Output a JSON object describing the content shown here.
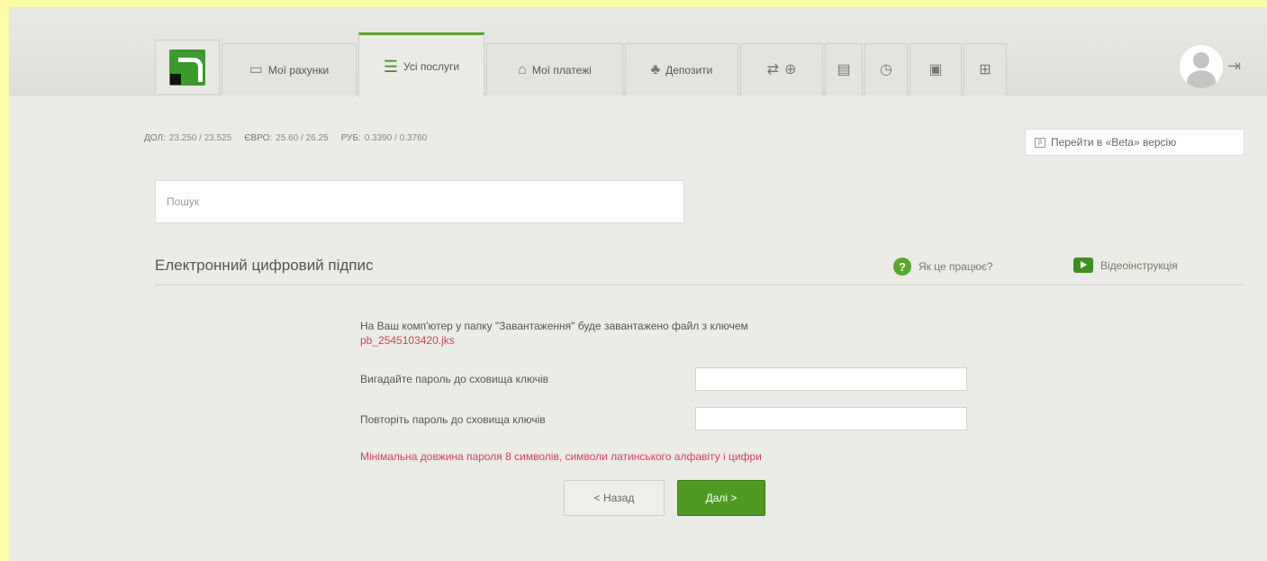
{
  "nav": {
    "tabs": [
      {
        "label": "Мої рахунки",
        "icon": "card-icon"
      },
      {
        "label": "Усі послуги",
        "icon": "list-icon",
        "active": true
      },
      {
        "label": "Мої платежі",
        "icon": "payments-icon"
      },
      {
        "label": "Депозити",
        "icon": "deposit-icon"
      }
    ],
    "icon_tabs": [
      "transport-icon",
      "document-icon",
      "history-icon",
      "chat-icon",
      "cart-icon"
    ]
  },
  "rates": [
    {
      "label": "ДОЛ:",
      "value": "23.250 / 23.525"
    },
    {
      "label": "ЄВРО:",
      "value": "25.60 / 26.25"
    },
    {
      "label": "РУБ:",
      "value": "0.3390 / 0.3760"
    }
  ],
  "beta": {
    "badge": "β",
    "label": "Перейти в «Beta» версію"
  },
  "search": {
    "placeholder": "Пошук"
  },
  "section": {
    "title": "Електронний цифровий підпис",
    "help_label": "Як це працює?",
    "video_label": "Відеоінструкція"
  },
  "form": {
    "notice": "На Ваш комп'ютер у папку \"Завантаження\" буде завантажено файл з ключем",
    "filename": "pb_2545103420.jks",
    "password_label": "Вигадайте пароль до сховища ключів",
    "password_repeat_label": "Повторіть пароль до сховища ключів",
    "warning": "Мінімальна довжина пароля 8 символів, символи латинського алфавіту і цифри",
    "back_label": "< Назад",
    "next_label": "Далі >"
  },
  "colors": {
    "brand_green": "#5aa829",
    "button_green": "#4f9a22",
    "warning_red": "#d0455a",
    "outer_background": "#fbfba8"
  }
}
